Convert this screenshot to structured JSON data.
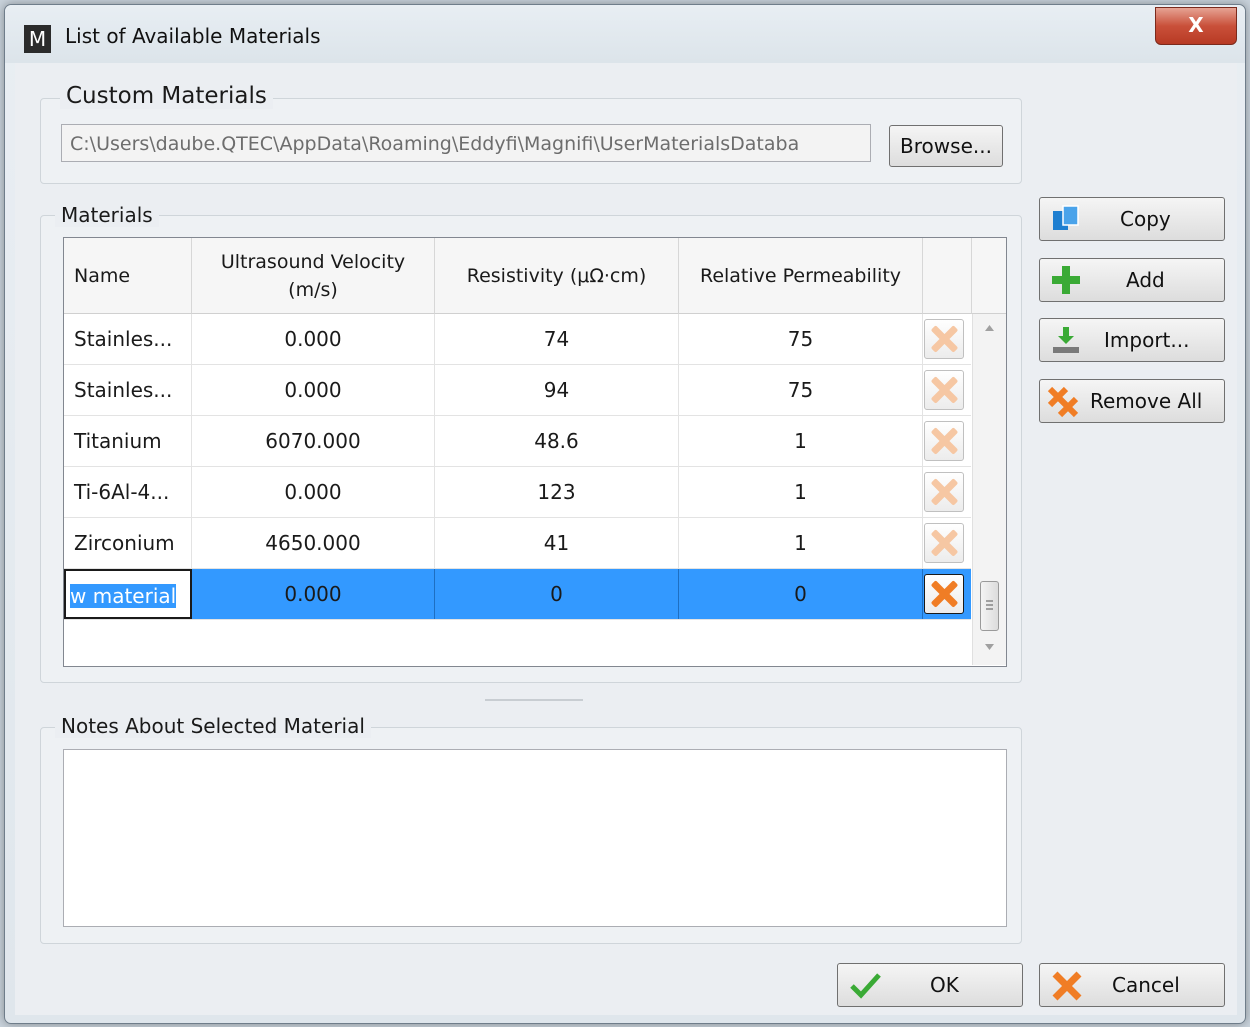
{
  "window": {
    "title": "List of Available Materials",
    "app_icon_letter": "M",
    "close_glyph": "X"
  },
  "custom_materials": {
    "title": "Custom Materials",
    "path_value": "C:\\Users\\daube.QTEC\\AppData\\Roaming\\Eddyfi\\Magnifi\\UserMaterialsDataba",
    "browse_label": "Browse..."
  },
  "materials": {
    "title": "Materials",
    "columns": [
      "Name",
      "Ultrasound Velocity\n(m/s)",
      "Resistivity (μΩ·cm)",
      "Relative Permeability"
    ],
    "rows": [
      {
        "name": "Stainles...",
        "velocity": "0.000",
        "resistivity": "74",
        "permeability": "75"
      },
      {
        "name": "Stainles...",
        "velocity": "0.000",
        "resistivity": "94",
        "permeability": "75"
      },
      {
        "name": "Titanium",
        "velocity": "6070.000",
        "resistivity": "48.6",
        "permeability": "1"
      },
      {
        "name": "Ti-6Al-4...",
        "velocity": "0.000",
        "resistivity": "123",
        "permeability": "1"
      },
      {
        "name": "Zirconium",
        "velocity": "4650.000",
        "resistivity": "41",
        "permeability": "1"
      },
      {
        "name": "w material",
        "velocity": "0.000",
        "resistivity": "0",
        "permeability": "0"
      }
    ],
    "selected_row": 5
  },
  "side_buttons": {
    "copy": "Copy",
    "add": "Add",
    "import": "Import...",
    "remove_all": "Remove All"
  },
  "notes": {
    "title": "Notes About Selected Material",
    "value": ""
  },
  "footer": {
    "ok": "OK",
    "cancel": "Cancel"
  },
  "colors": {
    "selection": "#3399ff",
    "delete_icon": "#f07d25",
    "add_icon": "#3aaa35",
    "copy_icon": "#1f7fd0",
    "ok_check": "#3aaa35"
  }
}
